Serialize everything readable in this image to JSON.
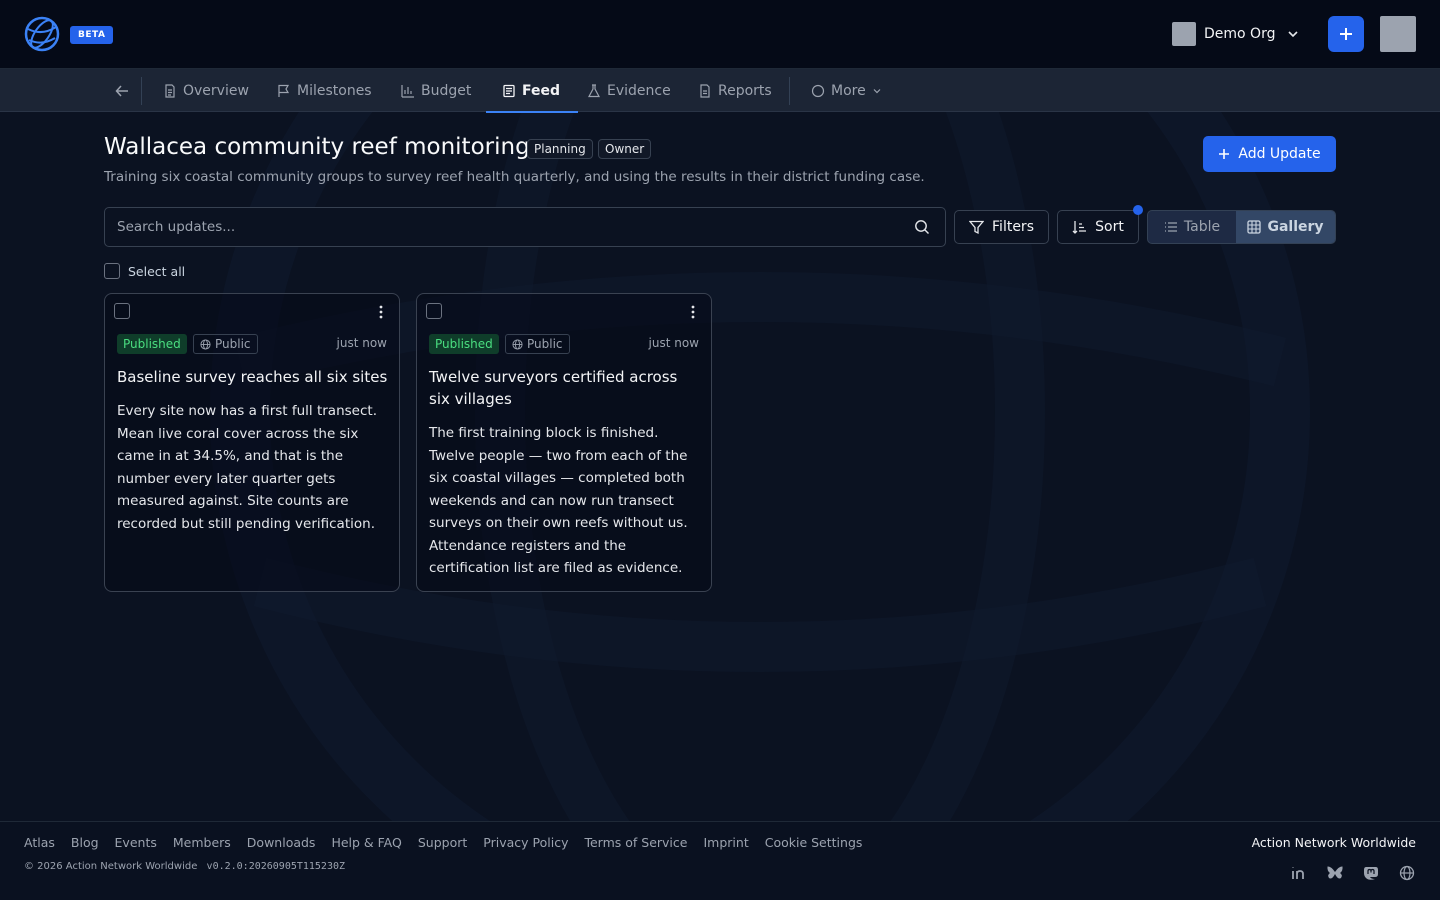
{
  "header": {
    "beta_label": "BETA",
    "org_name": "Demo Org"
  },
  "tabs": [
    {
      "label": "Overview",
      "icon": "document-icon"
    },
    {
      "label": "Milestones",
      "icon": "flag-icon"
    },
    {
      "label": "Budget",
      "icon": "chart-icon"
    },
    {
      "label": "Feed",
      "icon": "newspaper-icon",
      "active": true
    },
    {
      "label": "Evidence",
      "icon": "flask-icon"
    },
    {
      "label": "Reports",
      "icon": "file-icon"
    },
    {
      "label": "More",
      "icon": "circle-icon"
    }
  ],
  "project": {
    "title": "Wallacea community reef monitoring",
    "status_badge": "Planning",
    "role_badge": "Owner",
    "description": "Training six coastal community groups to survey reef health quarterly, and using the results in their district funding case."
  },
  "toolbar": {
    "add_update_label": "Add Update",
    "search_placeholder": "Search updates...",
    "filters_label": "Filters",
    "sort_label": "Sort",
    "view_table_label": "Table",
    "view_gallery_label": "Gallery",
    "select_all_label": "Select all"
  },
  "updates": [
    {
      "status": "Published",
      "visibility": "Public",
      "time": "just now",
      "title": "Baseline survey reaches all six sites",
      "body": "Every site now has a first full transect. Mean live coral cover across the six came in at 34.5%, and that is the number every later quarter gets measured against. Site counts are recorded but still pending verification."
    },
    {
      "status": "Published",
      "visibility": "Public",
      "time": "just now",
      "title": "Twelve surveyors certified across six villages",
      "body": "The first training block is finished. Twelve people — two from each of the six coastal villages — completed both weekends and can now run transect surveys on their own reefs without us. Attendance registers and the certification list are filed as evidence."
    }
  ],
  "footer": {
    "links": [
      "Atlas",
      "Blog",
      "Events",
      "Members",
      "Downloads",
      "Help & FAQ",
      "Support",
      "Privacy Policy",
      "Terms of Service",
      "Imprint",
      "Cookie Settings"
    ],
    "copyright": "© 2026 Action Network Worldwide",
    "version": "v0.2.0:20260905T115230Z",
    "brand": "Action Network Worldwide",
    "socials": [
      "linkedin-icon",
      "bluesky-icon",
      "mastodon-icon",
      "globe-icon"
    ]
  },
  "colors": {
    "accent": "#2563eb",
    "background": "#0b1221",
    "published": "#4ade80"
  }
}
